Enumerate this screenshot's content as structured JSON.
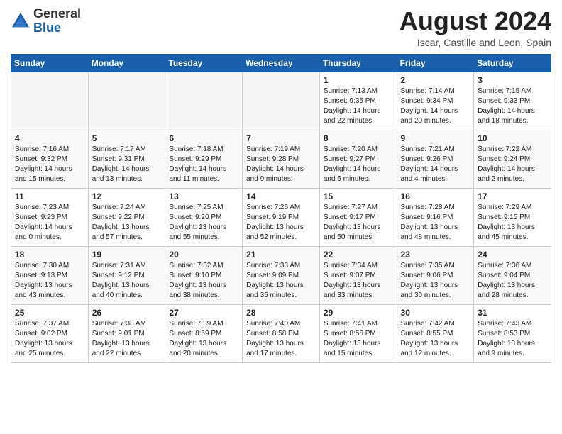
{
  "header": {
    "logo_general": "General",
    "logo_blue": "Blue",
    "month_title": "August 2024",
    "subtitle": "Iscar, Castille and Leon, Spain"
  },
  "days_of_week": [
    "Sunday",
    "Monday",
    "Tuesday",
    "Wednesday",
    "Thursday",
    "Friday",
    "Saturday"
  ],
  "weeks": [
    [
      {
        "day": "",
        "content": ""
      },
      {
        "day": "",
        "content": ""
      },
      {
        "day": "",
        "content": ""
      },
      {
        "day": "",
        "content": ""
      },
      {
        "day": "1",
        "content": "Sunrise: 7:13 AM\nSunset: 9:35 PM\nDaylight: 14 hours\nand 22 minutes."
      },
      {
        "day": "2",
        "content": "Sunrise: 7:14 AM\nSunset: 9:34 PM\nDaylight: 14 hours\nand 20 minutes."
      },
      {
        "day": "3",
        "content": "Sunrise: 7:15 AM\nSunset: 9:33 PM\nDaylight: 14 hours\nand 18 minutes."
      }
    ],
    [
      {
        "day": "4",
        "content": "Sunrise: 7:16 AM\nSunset: 9:32 PM\nDaylight: 14 hours\nand 15 minutes."
      },
      {
        "day": "5",
        "content": "Sunrise: 7:17 AM\nSunset: 9:31 PM\nDaylight: 14 hours\nand 13 minutes."
      },
      {
        "day": "6",
        "content": "Sunrise: 7:18 AM\nSunset: 9:29 PM\nDaylight: 14 hours\nand 11 minutes."
      },
      {
        "day": "7",
        "content": "Sunrise: 7:19 AM\nSunset: 9:28 PM\nDaylight: 14 hours\nand 9 minutes."
      },
      {
        "day": "8",
        "content": "Sunrise: 7:20 AM\nSunset: 9:27 PM\nDaylight: 14 hours\nand 6 minutes."
      },
      {
        "day": "9",
        "content": "Sunrise: 7:21 AM\nSunset: 9:26 PM\nDaylight: 14 hours\nand 4 minutes."
      },
      {
        "day": "10",
        "content": "Sunrise: 7:22 AM\nSunset: 9:24 PM\nDaylight: 14 hours\nand 2 minutes."
      }
    ],
    [
      {
        "day": "11",
        "content": "Sunrise: 7:23 AM\nSunset: 9:23 PM\nDaylight: 14 hours\nand 0 minutes."
      },
      {
        "day": "12",
        "content": "Sunrise: 7:24 AM\nSunset: 9:22 PM\nDaylight: 13 hours\nand 57 minutes."
      },
      {
        "day": "13",
        "content": "Sunrise: 7:25 AM\nSunset: 9:20 PM\nDaylight: 13 hours\nand 55 minutes."
      },
      {
        "day": "14",
        "content": "Sunrise: 7:26 AM\nSunset: 9:19 PM\nDaylight: 13 hours\nand 52 minutes."
      },
      {
        "day": "15",
        "content": "Sunrise: 7:27 AM\nSunset: 9:17 PM\nDaylight: 13 hours\nand 50 minutes."
      },
      {
        "day": "16",
        "content": "Sunrise: 7:28 AM\nSunset: 9:16 PM\nDaylight: 13 hours\nand 48 minutes."
      },
      {
        "day": "17",
        "content": "Sunrise: 7:29 AM\nSunset: 9:15 PM\nDaylight: 13 hours\nand 45 minutes."
      }
    ],
    [
      {
        "day": "18",
        "content": "Sunrise: 7:30 AM\nSunset: 9:13 PM\nDaylight: 13 hours\nand 43 minutes."
      },
      {
        "day": "19",
        "content": "Sunrise: 7:31 AM\nSunset: 9:12 PM\nDaylight: 13 hours\nand 40 minutes."
      },
      {
        "day": "20",
        "content": "Sunrise: 7:32 AM\nSunset: 9:10 PM\nDaylight: 13 hours\nand 38 minutes."
      },
      {
        "day": "21",
        "content": "Sunrise: 7:33 AM\nSunset: 9:09 PM\nDaylight: 13 hours\nand 35 minutes."
      },
      {
        "day": "22",
        "content": "Sunrise: 7:34 AM\nSunset: 9:07 PM\nDaylight: 13 hours\nand 33 minutes."
      },
      {
        "day": "23",
        "content": "Sunrise: 7:35 AM\nSunset: 9:06 PM\nDaylight: 13 hours\nand 30 minutes."
      },
      {
        "day": "24",
        "content": "Sunrise: 7:36 AM\nSunset: 9:04 PM\nDaylight: 13 hours\nand 28 minutes."
      }
    ],
    [
      {
        "day": "25",
        "content": "Sunrise: 7:37 AM\nSunset: 9:02 PM\nDaylight: 13 hours\nand 25 minutes."
      },
      {
        "day": "26",
        "content": "Sunrise: 7:38 AM\nSunset: 9:01 PM\nDaylight: 13 hours\nand 22 minutes."
      },
      {
        "day": "27",
        "content": "Sunrise: 7:39 AM\nSunset: 8:59 PM\nDaylight: 13 hours\nand 20 minutes."
      },
      {
        "day": "28",
        "content": "Sunrise: 7:40 AM\nSunset: 8:58 PM\nDaylight: 13 hours\nand 17 minutes."
      },
      {
        "day": "29",
        "content": "Sunrise: 7:41 AM\nSunset: 8:56 PM\nDaylight: 13 hours\nand 15 minutes."
      },
      {
        "day": "30",
        "content": "Sunrise: 7:42 AM\nSunset: 8:55 PM\nDaylight: 13 hours\nand 12 minutes."
      },
      {
        "day": "31",
        "content": "Sunrise: 7:43 AM\nSunset: 8:53 PM\nDaylight: 13 hours\nand 9 minutes."
      }
    ]
  ]
}
